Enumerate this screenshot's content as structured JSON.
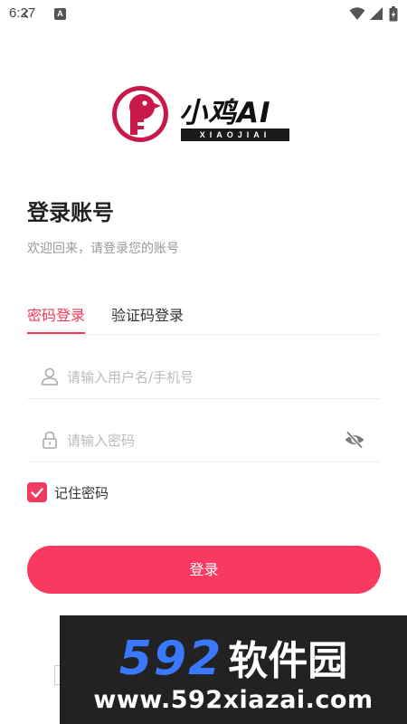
{
  "status_bar": {
    "time": "6:27",
    "notification_badge": "A",
    "icons": [
      "back-gesture-icon",
      "wifi-icon",
      "signal-icon",
      "battery-icon"
    ]
  },
  "logo": {
    "name": "小鸡AI",
    "subtitle": "XIAOJIAI",
    "icon": "chick-key-icon"
  },
  "header": {
    "title": "登录账号",
    "subtitle": "欢迎回来，请登录您的账号"
  },
  "tabs": [
    {
      "label": "密码登录",
      "active": true
    },
    {
      "label": "验证码登录",
      "active": false
    }
  ],
  "form": {
    "username": {
      "placeholder": "请输入用户名/手机号",
      "value": "",
      "icon": "user-icon"
    },
    "password": {
      "placeholder": "请输入密码",
      "value": "",
      "icon": "lock-icon",
      "toggle_icon": "eye-off-icon"
    },
    "remember": {
      "label": "记住密码",
      "checked": true
    }
  },
  "login_button": {
    "label": "登录"
  },
  "watermark": {
    "number": "592",
    "name": "软件园",
    "url": "www.592xiazai.com"
  },
  "colors": {
    "accent": "#f03a5f",
    "button": "#f9395f",
    "watermark_blue": "#3a78ff",
    "watermark_bg": "#222222"
  }
}
